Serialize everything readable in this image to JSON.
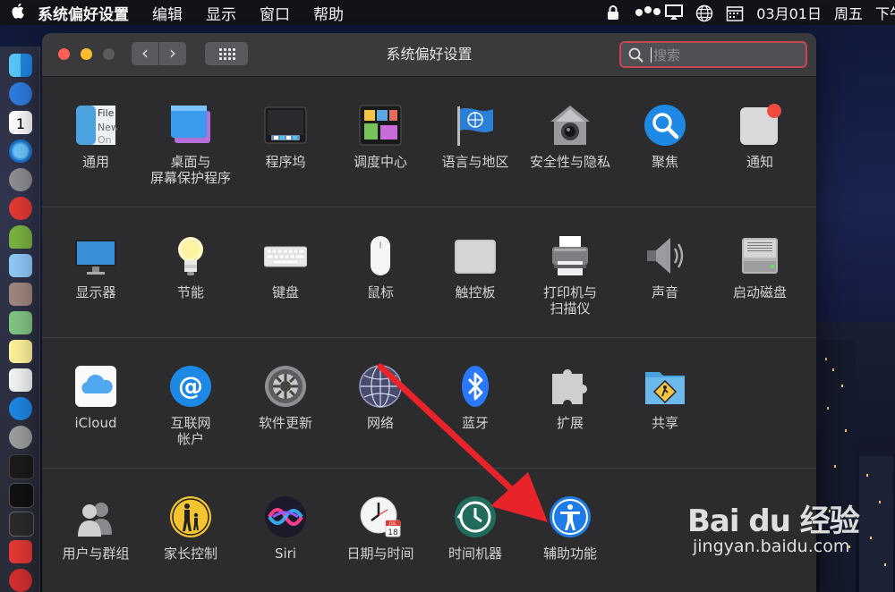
{
  "menubar": {
    "app_name": "系统偏好设置",
    "items": [
      "编辑",
      "显示",
      "窗口",
      "帮助"
    ],
    "date": "03月01日",
    "weekday": "周五",
    "time_prefix": "下午"
  },
  "window": {
    "title": "系统偏好设置",
    "search_placeholder": "搜索",
    "back_glyph": "‹",
    "forward_glyph": "›"
  },
  "sections": [
    {
      "panes": [
        {
          "label": "通用",
          "icon": "general-icon"
        },
        {
          "label": "桌面与\n屏幕保护程序",
          "icon": "desktop-screensaver-icon"
        },
        {
          "label": "程序坞",
          "icon": "dock-icon"
        },
        {
          "label": "调度中心",
          "icon": "mission-control-icon"
        },
        {
          "label": "语言与地区",
          "icon": "language-region-icon"
        },
        {
          "label": "安全性与隐私",
          "icon": "security-privacy-icon"
        },
        {
          "label": "聚焦",
          "icon": "spotlight-icon"
        },
        {
          "label": "通知",
          "icon": "notifications-icon"
        }
      ]
    },
    {
      "panes": [
        {
          "label": "显示器",
          "icon": "displays-icon"
        },
        {
          "label": "节能",
          "icon": "energy-saver-icon"
        },
        {
          "label": "键盘",
          "icon": "keyboard-icon"
        },
        {
          "label": "鼠标",
          "icon": "mouse-icon"
        },
        {
          "label": "触控板",
          "icon": "trackpad-icon"
        },
        {
          "label": "打印机与\n扫描仪",
          "icon": "printers-scanners-icon"
        },
        {
          "label": "声音",
          "icon": "sound-icon"
        },
        {
          "label": "启动磁盘",
          "icon": "startup-disk-icon"
        }
      ]
    },
    {
      "panes": [
        {
          "label": "iCloud",
          "icon": "icloud-icon"
        },
        {
          "label": "互联网\n帐户",
          "icon": "internet-accounts-icon"
        },
        {
          "label": "软件更新",
          "icon": "software-update-icon"
        },
        {
          "label": "网络",
          "icon": "network-icon"
        },
        {
          "label": "蓝牙",
          "icon": "bluetooth-icon"
        },
        {
          "label": "扩展",
          "icon": "extensions-icon"
        },
        {
          "label": "共享",
          "icon": "sharing-icon"
        }
      ]
    },
    {
      "panes": [
        {
          "label": "用户与群组",
          "icon": "users-groups-icon"
        },
        {
          "label": "家长控制",
          "icon": "parental-controls-icon"
        },
        {
          "label": "Siri",
          "icon": "siri-icon"
        },
        {
          "label": "日期与时间",
          "icon": "date-time-icon"
        },
        {
          "label": "时间机器",
          "icon": "time-machine-icon"
        },
        {
          "label": "辅助功能",
          "icon": "accessibility-icon"
        }
      ]
    }
  ],
  "calendar_icon": {
    "month": "JUL",
    "day": "18"
  },
  "dock_calendar_day": "1",
  "watermark": {
    "brand": "Bai du 经验",
    "url": "jingyan.baidu.com"
  },
  "colors": {
    "arrow": "#e8232a",
    "search_focus": "#c4484f",
    "window_bg": "#2c2c2e"
  }
}
